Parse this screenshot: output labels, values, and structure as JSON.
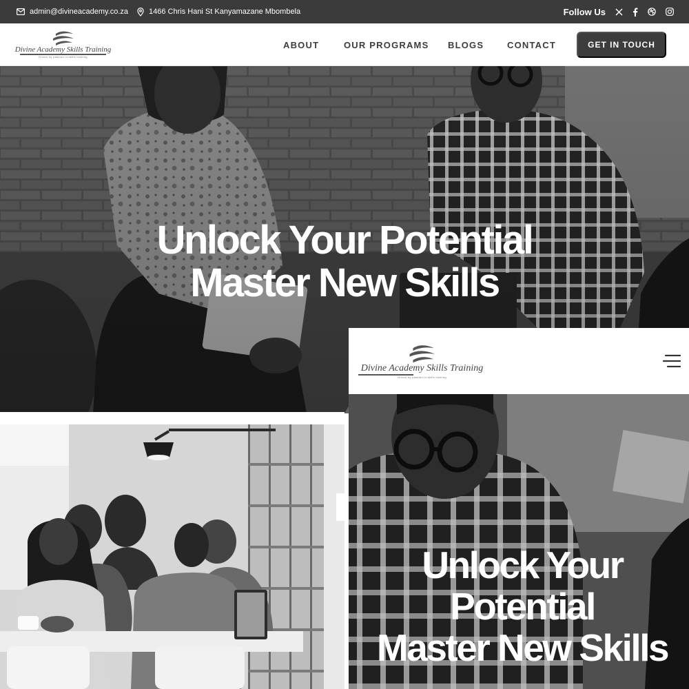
{
  "topbar": {
    "email": "admin@divineacademy.co.za",
    "address": "1466 Chris Hani St Kanyamazane Mbombela",
    "follow_label": "Follow Us",
    "social_icons": [
      "x-icon",
      "facebook-icon",
      "dribbble-icon",
      "instagram-icon"
    ]
  },
  "brand": {
    "name": "Divine Academy Skills Training",
    "tagline": "Driven by passion in skills training"
  },
  "nav": {
    "items": [
      {
        "label": "ABOUT"
      },
      {
        "label": "OUR PROGRAMS"
      },
      {
        "label": "BLOGS"
      },
      {
        "label": "CONTACT"
      }
    ],
    "cta_label": "GET IN TOUCH"
  },
  "hero": {
    "title_line1": "Unlock Your Potential",
    "title_line2": "Master New Skills"
  },
  "mobile": {
    "title_line1": "Unlock Your",
    "title_line2": "Potential",
    "title_line3": "Master New Skills"
  },
  "colors": {
    "topbar_bg": "#3b3b3b",
    "cta_bg": "#3d3d3d",
    "nav_text": "#3c3c3c"
  }
}
